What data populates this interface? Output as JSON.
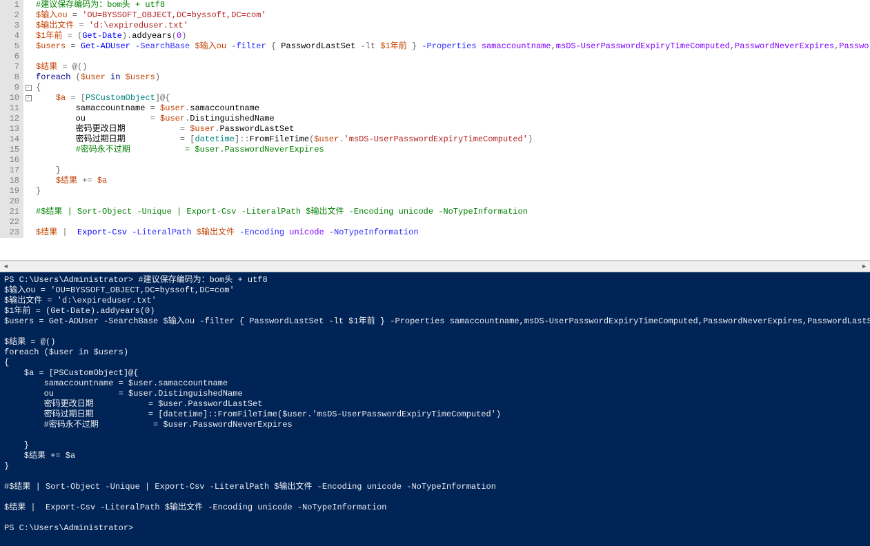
{
  "editor": {
    "lines": [
      {
        "n": "1",
        "fold": "",
        "tokens": [
          [
            "c-green",
            "#建议保存编码为：bom头 + utf8"
          ]
        ]
      },
      {
        "n": "2",
        "fold": "",
        "tokens": [
          [
            "c-var",
            "$输入ou"
          ],
          [
            "c-gray",
            " = "
          ],
          [
            "c-red",
            "'OU=BYSSOFT_OBJECT,DC=byssoft,DC=com'"
          ]
        ]
      },
      {
        "n": "3",
        "fold": "",
        "tokens": [
          [
            "c-var",
            "$输出文件"
          ],
          [
            "c-gray",
            " = "
          ],
          [
            "c-red",
            "'d:\\expireduser.txt'"
          ]
        ]
      },
      {
        "n": "4",
        "fold": "",
        "tokens": [
          [
            "c-var",
            "$1年前"
          ],
          [
            "c-gray",
            " = "
          ],
          [
            "c-gray",
            "("
          ],
          [
            "c-blue",
            "Get-Date"
          ],
          [
            "c-gray",
            ")."
          ],
          [
            "c-black",
            "addyears"
          ],
          [
            "c-gray",
            "("
          ],
          [
            "c-purple",
            "0"
          ],
          [
            "c-gray",
            ")"
          ]
        ]
      },
      {
        "n": "5",
        "fold": "",
        "tokens": [
          [
            "c-var",
            "$users"
          ],
          [
            "c-gray",
            " = "
          ],
          [
            "c-blue",
            "Get-ADUser"
          ],
          [
            "c-navy",
            " -SearchBase "
          ],
          [
            "c-var",
            "$输入ou"
          ],
          [
            "c-navy",
            " -filter"
          ],
          [
            "c-gray",
            " { "
          ],
          [
            "c-black",
            "PasswordLastSet "
          ],
          [
            "c-gray",
            "-lt "
          ],
          [
            "c-var",
            "$1年前"
          ],
          [
            "c-gray",
            " } "
          ],
          [
            "c-navy",
            "-Properties "
          ],
          [
            "c-purple",
            "samaccountname"
          ],
          [
            "c-gray",
            ","
          ],
          [
            "c-purple",
            "msDS-UserPasswordExpiryTimeComputed"
          ],
          [
            "c-gray",
            ","
          ],
          [
            "c-purple",
            "PasswordNeverExpires"
          ],
          [
            "c-gray",
            ","
          ],
          [
            "c-purple",
            "PasswordLastSet"
          ]
        ]
      },
      {
        "n": "6",
        "fold": "",
        "tokens": [
          [
            "c-black",
            ""
          ]
        ]
      },
      {
        "n": "7",
        "fold": "",
        "tokens": [
          [
            "c-var",
            "$结果"
          ],
          [
            "c-gray",
            " = @()"
          ]
        ]
      },
      {
        "n": "8",
        "fold": "",
        "tokens": [
          [
            "c-kw",
            "foreach"
          ],
          [
            "c-gray",
            " ("
          ],
          [
            "c-var",
            "$user"
          ],
          [
            "c-kw",
            " in "
          ],
          [
            "c-var",
            "$users"
          ],
          [
            "c-gray",
            ")"
          ]
        ]
      },
      {
        "n": "9",
        "fold": "box",
        "tokens": [
          [
            "c-gray",
            "{"
          ]
        ]
      },
      {
        "n": "10",
        "fold": "box",
        "tokens": [
          [
            "c-black",
            "    "
          ],
          [
            "c-var",
            "$a"
          ],
          [
            "c-gray",
            " = ["
          ],
          [
            "c-type",
            "PSCustomObject"
          ],
          [
            "c-gray",
            "]@{  "
          ]
        ]
      },
      {
        "n": "11",
        "fold": "",
        "tokens": [
          [
            "c-black",
            "        samaccountname "
          ],
          [
            "c-gray",
            "= "
          ],
          [
            "c-var",
            "$user"
          ],
          [
            "c-gray",
            "."
          ],
          [
            "c-black",
            "samaccountname"
          ]
        ]
      },
      {
        "n": "12",
        "fold": "",
        "tokens": [
          [
            "c-black",
            "        ou             "
          ],
          [
            "c-gray",
            "= "
          ],
          [
            "c-var",
            "$user"
          ],
          [
            "c-gray",
            "."
          ],
          [
            "c-black",
            "DistinguishedName"
          ]
        ]
      },
      {
        "n": "13",
        "fold": "",
        "tokens": [
          [
            "c-black",
            "        密码更改日期           "
          ],
          [
            "c-gray",
            "= "
          ],
          [
            "c-var",
            "$user"
          ],
          [
            "c-gray",
            "."
          ],
          [
            "c-black",
            "PasswordLastSet"
          ]
        ]
      },
      {
        "n": "14",
        "fold": "",
        "tokens": [
          [
            "c-black",
            "        密码过期日期           "
          ],
          [
            "c-gray",
            "= ["
          ],
          [
            "c-type",
            "datetime"
          ],
          [
            "c-gray",
            "]::"
          ],
          [
            "c-black",
            "FromFileTime"
          ],
          [
            "c-gray",
            "("
          ],
          [
            "c-var",
            "$user"
          ],
          [
            "c-gray",
            "."
          ],
          [
            "c-red",
            "'msDS-UserPasswordExpiryTimeComputed'"
          ],
          [
            "c-gray",
            ")"
          ]
        ]
      },
      {
        "n": "15",
        "fold": "",
        "tokens": [
          [
            "c-green",
            "        #密码永不过期           = $user.PasswordNeverExpires"
          ]
        ]
      },
      {
        "n": "16",
        "fold": "",
        "tokens": [
          [
            "c-black",
            ""
          ]
        ]
      },
      {
        "n": "17",
        "fold": "",
        "tokens": [
          [
            "c-gray",
            "    }"
          ]
        ]
      },
      {
        "n": "18",
        "fold": "",
        "tokens": [
          [
            "c-black",
            "    "
          ],
          [
            "c-var",
            "$结果"
          ],
          [
            "c-gray",
            " += "
          ],
          [
            "c-var",
            "$a"
          ]
        ]
      },
      {
        "n": "19",
        "fold": "",
        "tokens": [
          [
            "c-gray",
            "}"
          ]
        ]
      },
      {
        "n": "20",
        "fold": "",
        "tokens": [
          [
            "c-black",
            ""
          ]
        ]
      },
      {
        "n": "21",
        "fold": "",
        "tokens": [
          [
            "c-green",
            "#$结果 | Sort-Object -Unique | Export-Csv -LiteralPath $输出文件 -Encoding unicode -NoTypeInformation"
          ]
        ]
      },
      {
        "n": "22",
        "fold": "",
        "tokens": [
          [
            "c-black",
            ""
          ]
        ]
      },
      {
        "n": "23",
        "fold": "",
        "tokens": [
          [
            "c-var",
            "$结果"
          ],
          [
            "c-gray",
            " |  "
          ],
          [
            "c-blue",
            "Export-Csv"
          ],
          [
            "c-navy",
            " -LiteralPath "
          ],
          [
            "c-var",
            "$输出文件"
          ],
          [
            "c-navy",
            " -Encoding "
          ],
          [
            "c-purple",
            "unicode"
          ],
          [
            "c-navy",
            " -NoTypeInformation"
          ]
        ]
      }
    ]
  },
  "terminal": {
    "lines": [
      "PS C:\\Users\\Administrator> #建议保存编码为：bom头 + utf8",
      "$输入ou = 'OU=BYSSOFT_OBJECT,DC=byssoft,DC=com'",
      "$输出文件 = 'd:\\expireduser.txt'",
      "$1年前 = (Get-Date).addyears(0)",
      "$users = Get-ADUser -SearchBase $输入ou -filter { PasswordLastSet -lt $1年前 } -Properties samaccountname,msDS-UserPasswordExpiryTimeComputed,PasswordNeverExpires,PasswordLastSet",
      "",
      "$结果 = @()",
      "foreach ($user in $users)",
      "{",
      "    $a = [PSCustomObject]@{",
      "        samaccountname = $user.samaccountname",
      "        ou             = $user.DistinguishedName",
      "        密码更改日期           = $user.PasswordLastSet",
      "        密码过期日期           = [datetime]::FromFileTime($user.'msDS-UserPasswordExpiryTimeComputed')",
      "        #密码永不过期           = $user.PasswordNeverExpires",
      "",
      "    }",
      "    $结果 += $a",
      "}",
      "",
      "#$结果 | Sort-Object -Unique | Export-Csv -LiteralPath $输出文件 -Encoding unicode -NoTypeInformation",
      "",
      "$结果 |  Export-Csv -LiteralPath $输出文件 -Encoding unicode -NoTypeInformation",
      "",
      "PS C:\\Users\\Administrator>"
    ]
  },
  "scroll": {
    "left_arrow": "◄",
    "right_arrow": "►"
  }
}
